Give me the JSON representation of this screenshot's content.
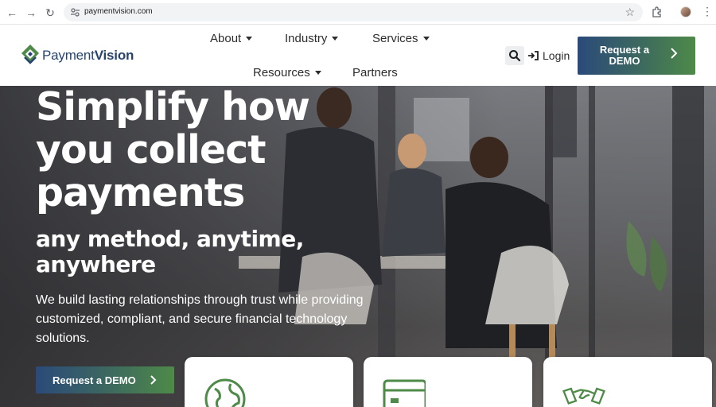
{
  "browser": {
    "url": "paymentvision.com",
    "icons": [
      "back-icon",
      "forward-icon",
      "reload-icon",
      "site-settings-icon",
      "bookmark-star-icon",
      "extensions-icon",
      "profile-avatar",
      "menu-kebab-icon"
    ]
  },
  "header": {
    "logo_text_light": "Payment",
    "logo_text_bold": "Vision",
    "nav": {
      "about": "About",
      "industry": "Industry",
      "services": "Services",
      "resources": "Resources",
      "partners": "Partners"
    },
    "login_label": "Login",
    "demo_button_label": "Request a DEMO"
  },
  "hero": {
    "headline": "Simplify how you collect payments",
    "subheadline": "any method, anytime, anywhere",
    "description": "We build lasting relationships through trust while providing customized, compliant, and secure financial technology solutions.",
    "cta_label": "Request a DEMO"
  },
  "cards": [
    {
      "icon": "globe-icon"
    },
    {
      "icon": "credit-card-icon"
    },
    {
      "icon": "handshake-icon"
    }
  ],
  "colors": {
    "brand_blue": "#27446e",
    "brand_green": "#4e8a48",
    "gradient_start": "#2b4a7a",
    "gradient_end": "#4e8a48"
  }
}
